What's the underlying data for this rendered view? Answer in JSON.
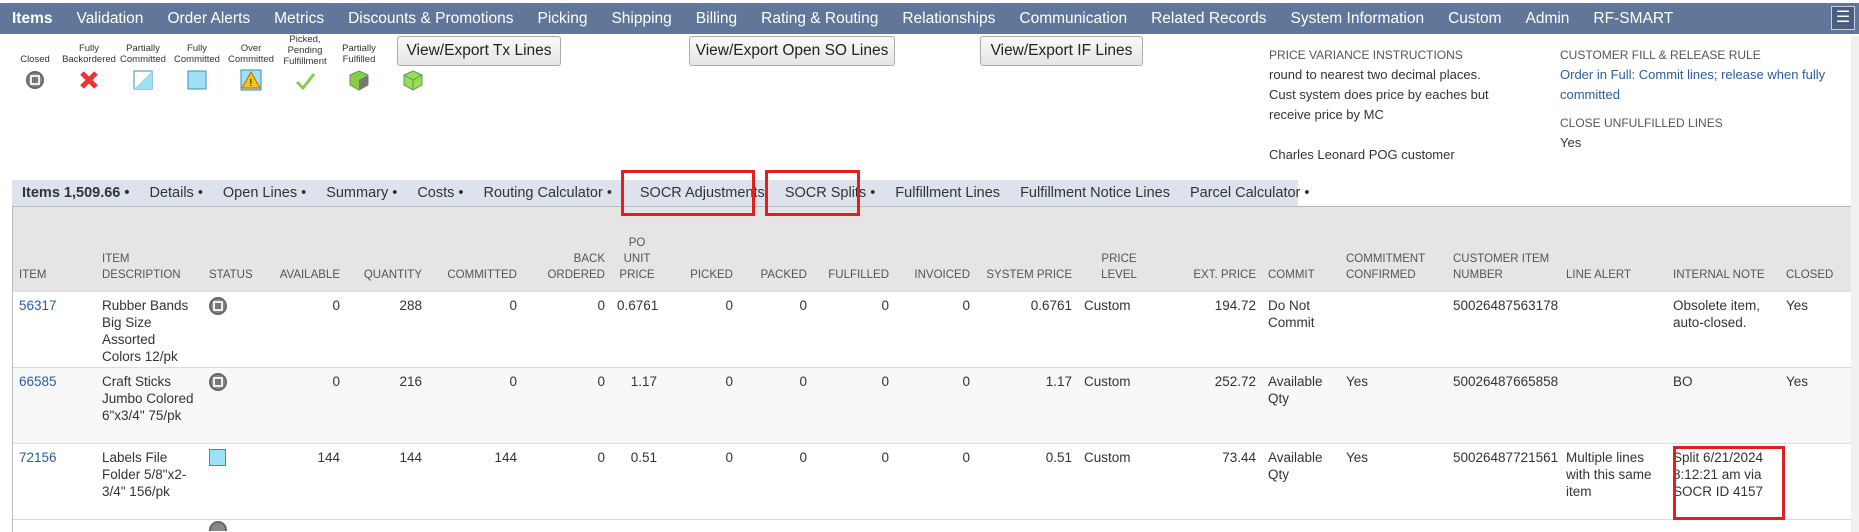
{
  "nav": {
    "items": [
      "Items",
      "Validation",
      "Order Alerts",
      "Metrics",
      "Discounts & Promotions",
      "Picking",
      "Shipping",
      "Billing",
      "Rating & Routing",
      "Relationships",
      "Communication",
      "Related Records",
      "System Information",
      "Custom",
      "Admin",
      "RF-SMART"
    ],
    "active": "Items",
    "menu_icon": "hamburger-icon"
  },
  "legend": [
    {
      "label": "Closed",
      "icon": "closed-circle-icon"
    },
    {
      "label": "Fully Backordered",
      "icon": "red-x-icon"
    },
    {
      "label": "Partially Committed",
      "icon": "half-square-icon"
    },
    {
      "label": "Fully Committed",
      "icon": "full-square-icon"
    },
    {
      "label": "Over Committed",
      "icon": "warning-icon"
    },
    {
      "label": "Picked, Pending Fulfillment",
      "icon": "checkmark-icon"
    },
    {
      "label": "Partially Fulfilled",
      "icon": "half-box-icon"
    },
    {
      "label": "Fully Fulfilled",
      "icon": "box-icon"
    }
  ],
  "buttons": {
    "tx": "View/Export Tx Lines",
    "open_so": "View/Export Open SO Lines",
    "if": "View/Export IF Lines"
  },
  "info": {
    "pvi_label": "PRICE VARIANCE INSTRUCTIONS",
    "pvi_value": "round to nearest two decimal places. Cust system does price by eaches but receive price by MC",
    "customer_note": "Charles Leonard POG customer",
    "cfr_label": "CUSTOMER FILL & RELEASE RULE",
    "cfr_value": "Order in Full: Commit lines; release when fully committed",
    "cul_label": "CLOSE UNFULFILLED LINES",
    "cul_value": "Yes"
  },
  "tabs": [
    "Items 1,509.66 •",
    "Details •",
    "Open Lines •",
    "Summary •",
    "Costs •",
    "Routing Calculator •",
    "SOCR Adjustments",
    "SOCR Splits •",
    "Fulfillment Lines",
    "Fulfillment Notice Lines",
    "Parcel Calculator •"
  ],
  "columns": [
    "ITEM",
    "ITEM DESCRIPTION",
    "STATUS",
    "AVAILABLE",
    "QUANTITY",
    "COMMITTED",
    "BACK ORDERED",
    "PO UNIT PRICE",
    "PICKED",
    "PACKED",
    "FULFILLED",
    "INVOICED",
    "SYSTEM PRICE",
    "PRICE LEVEL",
    "EXT. PRICE",
    "COMMIT",
    "COMMITMENT CONFIRMED",
    "CUSTOMER ITEM NUMBER",
    "LINE ALERT",
    "INTERNAL NOTE",
    "CLOSED"
  ],
  "rows": [
    {
      "item": "56317",
      "description": "Rubber Bands Big Size Assorted Colors 12/pk",
      "status": "closed",
      "available": "0",
      "quantity": "288",
      "committed": "0",
      "back_ordered": "0",
      "po_unit_price": "0.6761",
      "picked": "0",
      "packed": "0",
      "fulfilled": "0",
      "invoiced": "0",
      "system_price": "0.6761",
      "price_level": "Custom",
      "ext_price": "194.72",
      "commit": "Do Not Commit",
      "commitment_confirmed": "",
      "customer_item_number": "50026487563178",
      "line_alert": "",
      "internal_note": "Obsolete item, auto-closed.",
      "closed": "Yes"
    },
    {
      "item": "66585",
      "description": "Craft Sticks Jumbo Colored 6\"x3/4\" 75/pk",
      "status": "closed",
      "available": "0",
      "quantity": "216",
      "committed": "0",
      "back_ordered": "0",
      "po_unit_price": "1.17",
      "picked": "0",
      "packed": "0",
      "fulfilled": "0",
      "invoiced": "0",
      "system_price": "1.17",
      "price_level": "Custom",
      "ext_price": "252.72",
      "commit": "Available Qty",
      "commitment_confirmed": "Yes",
      "customer_item_number": "50026487665858",
      "line_alert": "",
      "internal_note": "BO",
      "closed": "Yes"
    },
    {
      "item": "72156",
      "description": "Labels File Folder 5/8\"x2-3/4\" 156/pk",
      "status": "fully-committed",
      "available": "144",
      "quantity": "144",
      "committed": "144",
      "back_ordered": "0",
      "po_unit_price": "0.51",
      "picked": "0",
      "packed": "0",
      "fulfilled": "0",
      "invoiced": "0",
      "system_price": "0.51",
      "price_level": "Custom",
      "ext_price": "73.44",
      "commit": "Available Qty",
      "commitment_confirmed": "Yes",
      "customer_item_number": "50026487721561",
      "line_alert": "Multiple lines with this same item",
      "internal_note": "Split 6/21/2024 8:12:21 am via SOCR ID 4157",
      "closed": ""
    }
  ],
  "highlight_color": "#e02020"
}
